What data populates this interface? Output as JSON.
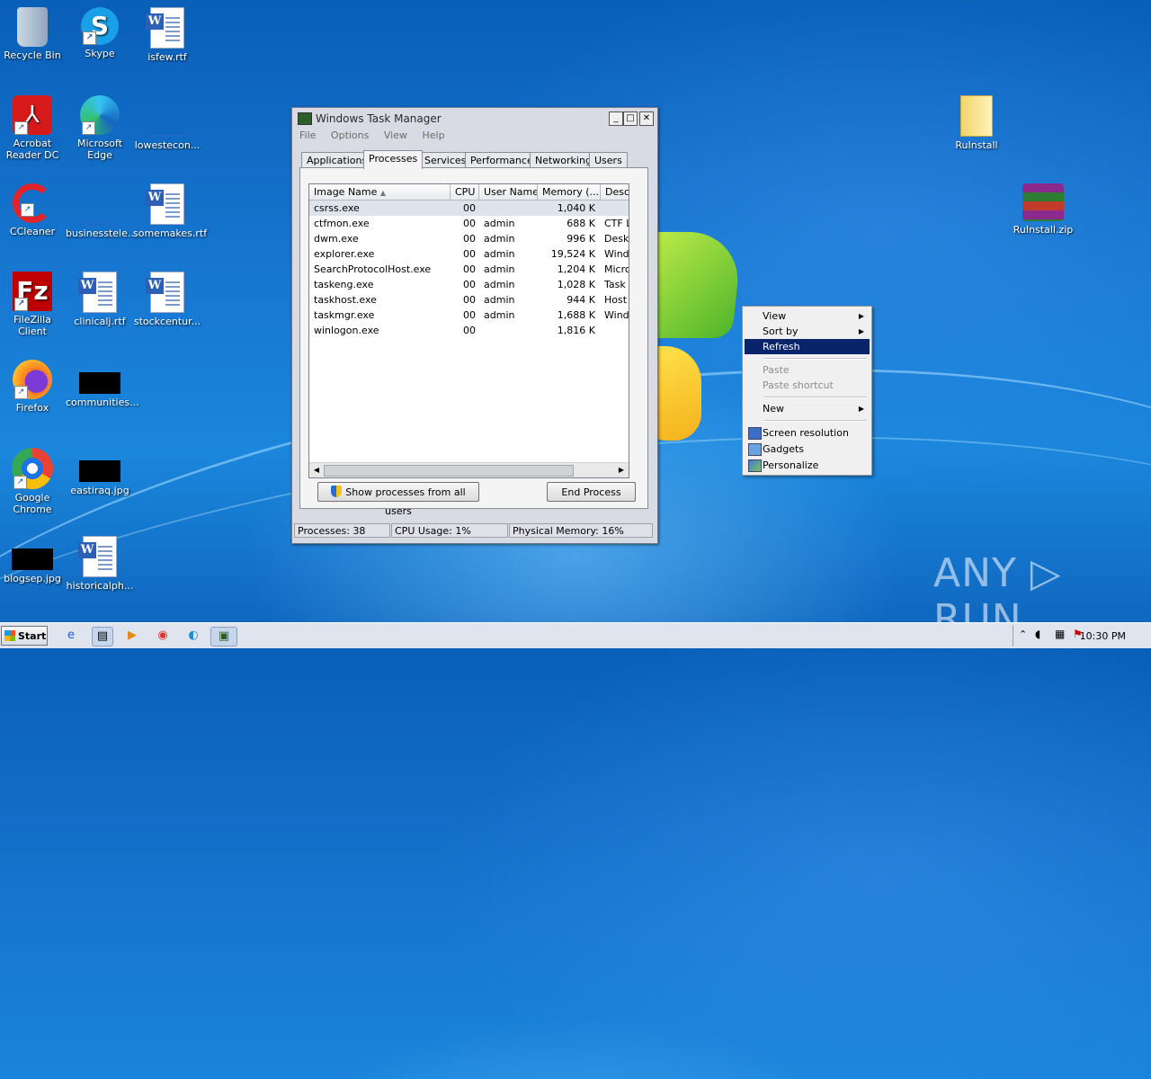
{
  "desktop": {
    "icons": [
      {
        "label": "Recycle Bin"
      },
      {
        "label": "Skype"
      },
      {
        "label": "isfew.rtf"
      },
      {
        "label": "Acrobat Reader DC"
      },
      {
        "label": "Microsoft Edge"
      },
      {
        "label": "lowestecon..."
      },
      {
        "label": "CCleaner"
      },
      {
        "label": "businesstele..."
      },
      {
        "label": "somemakes.rtf"
      },
      {
        "label": "FileZilla Client"
      },
      {
        "label": "clinicalj.rtf"
      },
      {
        "label": "stockcentur..."
      },
      {
        "label": "Firefox"
      },
      {
        "label": "communities..."
      },
      {
        "label": "Google Chrome"
      },
      {
        "label": "eastiraq.jpg"
      },
      {
        "label": "blogsep.jpg"
      },
      {
        "label": "historicalph..."
      },
      {
        "label": "RuInstall"
      },
      {
        "label": "RuInstall.zip"
      }
    ],
    "watermark": "ANY ▷ RUN"
  },
  "taskmgr": {
    "title": "Windows Task Manager",
    "menu": [
      "File",
      "Options",
      "View",
      "Help"
    ],
    "tabs": [
      "Applications",
      "Processes",
      "Services",
      "Performance",
      "Networking",
      "Users"
    ],
    "active_tab": "Processes",
    "columns": [
      "Image Name",
      "CPU",
      "User Name",
      "Memory (...",
      "Desc"
    ],
    "rows": [
      {
        "name": "csrss.exe",
        "cpu": "00",
        "user": "",
        "mem": "1,040 K",
        "desc": ""
      },
      {
        "name": "ctfmon.exe",
        "cpu": "00",
        "user": "admin",
        "mem": "688 K",
        "desc": "CTF L"
      },
      {
        "name": "dwm.exe",
        "cpu": "00",
        "user": "admin",
        "mem": "996 K",
        "desc": "Deskt"
      },
      {
        "name": "explorer.exe",
        "cpu": "00",
        "user": "admin",
        "mem": "19,524 K",
        "desc": "Wind"
      },
      {
        "name": "SearchProtocolHost.exe",
        "cpu": "00",
        "user": "admin",
        "mem": "1,204 K",
        "desc": "Micro"
      },
      {
        "name": "taskeng.exe",
        "cpu": "00",
        "user": "admin",
        "mem": "1,028 K",
        "desc": "Task"
      },
      {
        "name": "taskhost.exe",
        "cpu": "00",
        "user": "admin",
        "mem": "944 K",
        "desc": "Host"
      },
      {
        "name": "taskmgr.exe",
        "cpu": "00",
        "user": "admin",
        "mem": "1,688 K",
        "desc": "Wind"
      },
      {
        "name": "winlogon.exe",
        "cpu": "00",
        "user": "",
        "mem": "1,816 K",
        "desc": ""
      }
    ],
    "show_all_button": "Show processes from all users",
    "end_process_button": "End Process",
    "status": {
      "processes": "Processes: 38",
      "cpu": "CPU Usage: 1%",
      "memory": "Physical Memory: 16%"
    }
  },
  "context_menu": {
    "view": "View",
    "sort_by": "Sort by",
    "refresh": "Refresh",
    "paste": "Paste",
    "paste_shortcut": "Paste shortcut",
    "new": "New",
    "screen_resolution": "Screen resolution",
    "gadgets": "Gadgets",
    "personalize": "Personalize"
  },
  "taskbar": {
    "start": "Start",
    "clock": "10:30 PM"
  }
}
